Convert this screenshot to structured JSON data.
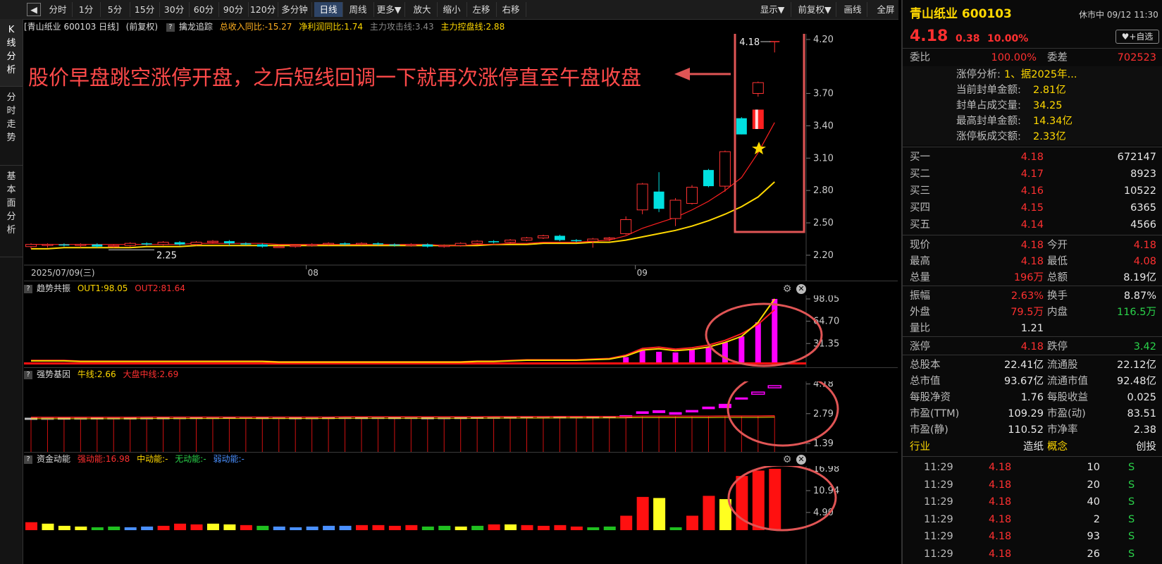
{
  "toolbar": {
    "items": [
      "分时",
      "1分",
      "5分",
      "15分",
      "30分",
      "60分",
      "90分",
      "120分",
      "多分钟",
      "日线",
      "周线",
      "更多▼",
      "放大",
      "缩小",
      "左移",
      "右移"
    ],
    "active": "日线",
    "right_items": [
      "显示▼",
      "前复权▼",
      "画线",
      "全屏"
    ]
  },
  "left_tabs": [
    "K线分析",
    "分时走势",
    "基本面分析"
  ],
  "kline_header": {
    "stock": "[青山纸业 600103 日线]",
    "adj": "(前复权)",
    "indicator": "擒龙追踪",
    "rev": "总收入同比:-15.27",
    "profit": "净利润同比:1.74",
    "attack": "主力攻击线:3.43",
    "control": "主力控盘线:2.88"
  },
  "kline": {
    "annotation": "股价早盘跳空涨停开盘，之后短线回调一下就再次涨停直至午盘收盘",
    "price_axis": [
      "4.20",
      "3.70",
      "3.40",
      "3.10",
      "2.80",
      "2.50",
      "2.20"
    ],
    "date_labels": [
      "2025/07/09(三)",
      "08",
      "09"
    ],
    "low_label": "2.25",
    "high_label": "4.18",
    "candles": [
      [
        2.28,
        2.3,
        2.26,
        2.31
      ],
      [
        2.29,
        2.3,
        2.27,
        2.31
      ],
      [
        2.3,
        2.29,
        2.28,
        2.31
      ],
      [
        2.29,
        2.3,
        2.27,
        2.31
      ],
      [
        2.3,
        2.28,
        2.27,
        2.31
      ],
      [
        2.28,
        2.29,
        2.27,
        2.3
      ],
      [
        2.29,
        2.31,
        2.28,
        2.32
      ],
      [
        2.31,
        2.3,
        2.29,
        2.32
      ],
      [
        2.3,
        2.32,
        2.29,
        2.33
      ],
      [
        2.32,
        2.3,
        2.29,
        2.33
      ],
      [
        2.3,
        2.32,
        2.29,
        2.33
      ],
      [
        2.32,
        2.33,
        2.31,
        2.34
      ],
      [
        2.33,
        2.31,
        2.29,
        2.34
      ],
      [
        2.31,
        2.3,
        2.29,
        2.32
      ],
      [
        2.3,
        2.28,
        2.27,
        2.31
      ],
      [
        2.28,
        2.28,
        2.27,
        2.29
      ],
      [
        2.28,
        2.29,
        2.27,
        2.3
      ],
      [
        2.29,
        2.3,
        2.28,
        2.31
      ],
      [
        2.3,
        2.31,
        2.29,
        2.32
      ],
      [
        2.31,
        2.3,
        2.29,
        2.32
      ],
      [
        2.3,
        2.31,
        2.29,
        2.32
      ],
      [
        2.31,
        2.3,
        2.29,
        2.32
      ],
      [
        2.3,
        2.29,
        2.28,
        2.31
      ],
      [
        2.29,
        2.3,
        2.28,
        2.31
      ],
      [
        2.3,
        2.28,
        2.27,
        2.31
      ],
      [
        2.28,
        2.29,
        2.27,
        2.3
      ],
      [
        2.29,
        2.31,
        2.28,
        2.32
      ],
      [
        2.31,
        2.33,
        2.3,
        2.34
      ],
      [
        2.33,
        2.32,
        2.31,
        2.34
      ],
      [
        2.32,
        2.34,
        2.31,
        2.35
      ],
      [
        2.34,
        2.36,
        2.33,
        2.37
      ],
      [
        2.36,
        2.38,
        2.35,
        2.39
      ],
      [
        2.38,
        2.34,
        2.33,
        2.39
      ],
      [
        2.34,
        2.33,
        2.32,
        2.35
      ],
      [
        2.33,
        2.35,
        2.27,
        2.36
      ],
      [
        2.35,
        2.36,
        2.33,
        2.37
      ],
      [
        2.4,
        2.53,
        2.39,
        2.56
      ],
      [
        2.62,
        2.86,
        2.58,
        2.87
      ],
      [
        2.79,
        2.63,
        2.6,
        2.97
      ],
      [
        2.54,
        2.71,
        2.47,
        2.73
      ],
      [
        2.68,
        2.83,
        2.67,
        2.85
      ],
      [
        2.99,
        2.84,
        2.83,
        3.0
      ],
      [
        2.84,
        3.16,
        2.79,
        3.17
      ],
      [
        3.47,
        3.32,
        3.32,
        3.48
      ],
      [
        3.7,
        3.8,
        3.67,
        3.81
      ],
      [
        4.08,
        4.18,
        4.08,
        4.18
      ]
    ],
    "ma_red": [
      2.3,
      2.3,
      2.3,
      2.3,
      2.3,
      2.3,
      2.3,
      2.3,
      2.3,
      2.3,
      2.31,
      2.31,
      2.31,
      2.31,
      2.31,
      2.3,
      2.3,
      2.3,
      2.3,
      2.3,
      2.3,
      2.3,
      2.3,
      2.3,
      2.3,
      2.29,
      2.29,
      2.3,
      2.3,
      2.31,
      2.31,
      2.32,
      2.32,
      2.32,
      2.33,
      2.34,
      2.38,
      2.45,
      2.5,
      2.55,
      2.62,
      2.7,
      2.8,
      2.92,
      3.15,
      3.43
    ],
    "ma_yellow": [
      2.26,
      2.26,
      2.27,
      2.27,
      2.27,
      2.27,
      2.27,
      2.28,
      2.28,
      2.28,
      2.29,
      2.29,
      2.29,
      2.29,
      2.29,
      2.29,
      2.29,
      2.29,
      2.29,
      2.29,
      2.29,
      2.29,
      2.29,
      2.29,
      2.29,
      2.29,
      2.29,
      2.29,
      2.3,
      2.3,
      2.3,
      2.31,
      2.31,
      2.31,
      2.32,
      2.32,
      2.34,
      2.37,
      2.4,
      2.43,
      2.47,
      2.52,
      2.58,
      2.65,
      2.74,
      2.88
    ]
  },
  "trend_panel": {
    "title": "趋势共振",
    "out1": "OUT1:98.05",
    "out2": "OUT2:81.64",
    "axis": [
      "98.05",
      "64.70",
      "31.35"
    ],
    "bars": [
      2,
      3,
      3,
      2,
      2,
      3,
      3,
      2,
      2,
      3,
      3,
      3,
      3,
      2,
      2,
      2,
      2,
      2,
      3,
      3,
      2,
      2,
      2,
      2,
      2,
      2,
      2,
      3,
      3,
      3,
      3,
      3,
      2,
      2,
      3,
      3,
      11,
      21,
      19,
      18,
      22,
      26,
      33,
      42,
      63,
      98.05
    ],
    "ma": [
      6,
      6,
      6,
      5,
      5,
      5,
      5,
      5,
      5,
      5,
      5,
      5,
      5,
      5,
      5,
      4,
      4,
      4,
      4,
      4,
      4,
      4,
      4,
      4,
      4,
      4,
      4,
      5,
      5,
      6,
      7,
      7,
      7,
      7,
      8,
      9,
      14,
      24,
      26,
      23,
      25,
      29,
      36,
      46,
      60,
      82
    ]
  },
  "strong_panel": {
    "title": "强势基因",
    "bull": "牛线:2.66",
    "market": "大盘中线:2.69",
    "axis": [
      "4.18",
      "2.79",
      "1.39"
    ],
    "boxes": [
      [
        2.58,
        2.6
      ],
      [
        2.6,
        2.58
      ],
      [
        2.58,
        2.61
      ],
      [
        2.61,
        2.59
      ],
      [
        2.59,
        2.62
      ],
      [
        2.62,
        2.6
      ],
      [
        2.6,
        2.62
      ],
      [
        2.62,
        2.61
      ],
      [
        2.61,
        2.63
      ],
      [
        2.63,
        2.62
      ],
      [
        2.62,
        2.64
      ],
      [
        2.64,
        2.63
      ],
      [
        2.63,
        2.65
      ],
      [
        2.65,
        2.63
      ],
      [
        2.63,
        2.64
      ],
      [
        2.64,
        2.62
      ],
      [
        2.62,
        2.63
      ],
      [
        2.63,
        2.62
      ],
      [
        2.62,
        2.64
      ],
      [
        2.64,
        2.63
      ],
      [
        2.63,
        2.64
      ],
      [
        2.64,
        2.63
      ],
      [
        2.63,
        2.64
      ],
      [
        2.64,
        2.62
      ],
      [
        2.62,
        2.63
      ],
      [
        2.63,
        2.62
      ],
      [
        2.62,
        2.64
      ],
      [
        2.64,
        2.65
      ],
      [
        2.65,
        2.64
      ],
      [
        2.64,
        2.66
      ],
      [
        2.66,
        2.67
      ],
      [
        2.67,
        2.66
      ],
      [
        2.66,
        2.67
      ],
      [
        2.67,
        2.66
      ],
      [
        2.66,
        2.67
      ],
      [
        2.67,
        2.68
      ],
      [
        2.66,
        2.72
      ],
      [
        2.78,
        2.9
      ],
      [
        2.95,
        2.82
      ],
      [
        2.74,
        2.86
      ],
      [
        2.85,
        2.96
      ],
      [
        3.0,
        3.12
      ],
      [
        3.05,
        3.25
      ],
      [
        3.45,
        3.55
      ],
      [
        3.72,
        3.8
      ],
      [
        4.05,
        4.1
      ]
    ],
    "line": [
      2.62,
      2.62,
      2.62,
      2.62,
      2.62,
      2.62,
      2.62,
      2.63,
      2.63,
      2.63,
      2.63,
      2.63,
      2.63,
      2.63,
      2.63,
      2.63,
      2.63,
      2.63,
      2.63,
      2.64,
      2.64,
      2.64,
      2.64,
      2.64,
      2.64,
      2.64,
      2.64,
      2.64,
      2.65,
      2.65,
      2.65,
      2.65,
      2.66,
      2.66,
      2.66,
      2.66,
      2.66,
      2.67,
      2.67,
      2.67,
      2.67,
      2.67,
      2.68,
      2.68,
      2.68,
      2.69
    ]
  },
  "money_panel": {
    "title": "资金动能",
    "strong": "强动能:16.98",
    "mid": "中动能:-",
    "none": "无动能:-",
    "weak": "弱动能:-",
    "axis": [
      "16.98",
      "10.94",
      "4.90"
    ],
    "bars": [
      [
        2.2,
        "r"
      ],
      [
        1.8,
        "y"
      ],
      [
        1.2,
        "y"
      ],
      [
        1.0,
        "y"
      ],
      [
        0.8,
        "g"
      ],
      [
        1.0,
        "g"
      ],
      [
        0.8,
        "b"
      ],
      [
        1.0,
        "b"
      ],
      [
        1.2,
        "r"
      ],
      [
        1.8,
        "r"
      ],
      [
        1.6,
        "r"
      ],
      [
        1.8,
        "y"
      ],
      [
        1.6,
        "y"
      ],
      [
        1.4,
        "r"
      ],
      [
        1.2,
        "g"
      ],
      [
        1.0,
        "b"
      ],
      [
        0.8,
        "b"
      ],
      [
        1.0,
        "b"
      ],
      [
        1.2,
        "b"
      ],
      [
        1.2,
        "b"
      ],
      [
        1.4,
        "r"
      ],
      [
        1.4,
        "r"
      ],
      [
        1.2,
        "r"
      ],
      [
        1.4,
        "r"
      ],
      [
        1.0,
        "g"
      ],
      [
        1.2,
        "g"
      ],
      [
        1.0,
        "y"
      ],
      [
        1.2,
        "g"
      ],
      [
        1.6,
        "r"
      ],
      [
        1.6,
        "y"
      ],
      [
        1.4,
        "r"
      ],
      [
        1.2,
        "r"
      ],
      [
        1.4,
        "r"
      ],
      [
        1.0,
        "r"
      ],
      [
        0.8,
        "g"
      ],
      [
        1.0,
        "g"
      ],
      [
        4.0,
        "r"
      ],
      [
        9.2,
        "r"
      ],
      [
        8.9,
        "y"
      ],
      [
        0.8,
        "g"
      ],
      [
        4.0,
        "r"
      ],
      [
        9.5,
        "r"
      ],
      [
        8.6,
        "y"
      ],
      [
        15.0,
        "r"
      ],
      [
        16.5,
        "r"
      ],
      [
        16.98,
        "r"
      ]
    ]
  },
  "colors": {
    "accent_red": "#ff3030",
    "highlight_box": "#e05555",
    "up": "#ff3232",
    "down": "#00e0e0",
    "yellow": "#ffd800",
    "magenta": "#ff00ff",
    "green": "#2ad24a",
    "blue": "#4a90ff"
  },
  "right": {
    "name": "青山纸业 600103",
    "status": "休市中 09/12 11:30",
    "price": "4.18",
    "change": "0.38",
    "pct": "10.00%",
    "watch_btn": "+自选",
    "weibi_l": "委比",
    "weibi_v": "100.00%",
    "weicha_l": "委差",
    "weicha_v": "702523",
    "zt_rows": [
      [
        "涨停分析:",
        "1、据2025年..."
      ],
      [
        "当前封单金额:",
        "2.81亿"
      ],
      [
        "封单占成交量:",
        "34.25"
      ],
      [
        "最高封单金额:",
        "14.34亿"
      ],
      [
        "涨停板成交额:",
        "2.33亿"
      ]
    ],
    "bids": [
      [
        "买一",
        "4.18",
        "672147"
      ],
      [
        "买二",
        "4.17",
        "8923"
      ],
      [
        "买三",
        "4.16",
        "10522"
      ],
      [
        "买四",
        "4.15",
        "6365"
      ],
      [
        "买五",
        "4.14",
        "4566"
      ]
    ],
    "stats1": [
      [
        "现价",
        "4.18",
        "今开",
        "4.18"
      ],
      [
        "最高",
        "4.18",
        "最低",
        "4.08"
      ],
      [
        "总量",
        "196万",
        "总额",
        "8.19亿"
      ]
    ],
    "stats2": [
      [
        "振幅",
        "2.63%",
        "换手",
        "8.87%"
      ],
      [
        "外盘",
        "79.5万",
        "内盘",
        "116.5万"
      ],
      [
        "量比",
        "1.21",
        "",
        ""
      ]
    ],
    "limit": [
      "涨停",
      "4.18",
      "跌停",
      "3.42"
    ],
    "fund": [
      [
        "总股本",
        "22.41亿",
        "流通股",
        "22.12亿"
      ],
      [
        "总市值",
        "93.67亿",
        "流通市值",
        "92.48亿"
      ],
      [
        "每股净资",
        "1.76",
        "每股收益",
        "0.025"
      ],
      [
        "市盈(TTM)",
        "109.29",
        "市盈(动)",
        "83.51"
      ],
      [
        "市盈(静)",
        "110.52",
        "市净率",
        "2.38"
      ]
    ],
    "industry": [
      "行业",
      "造纸",
      "概念",
      "创投"
    ],
    "ticks": [
      [
        "11:29",
        "4.18",
        "10",
        "S"
      ],
      [
        "11:29",
        "4.18",
        "20",
        "S"
      ],
      [
        "11:29",
        "4.18",
        "40",
        "S"
      ],
      [
        "11:29",
        "4.18",
        "2",
        "S"
      ],
      [
        "11:29",
        "4.18",
        "93",
        "S"
      ],
      [
        "11:29",
        "4.18",
        "26",
        "S"
      ]
    ]
  }
}
